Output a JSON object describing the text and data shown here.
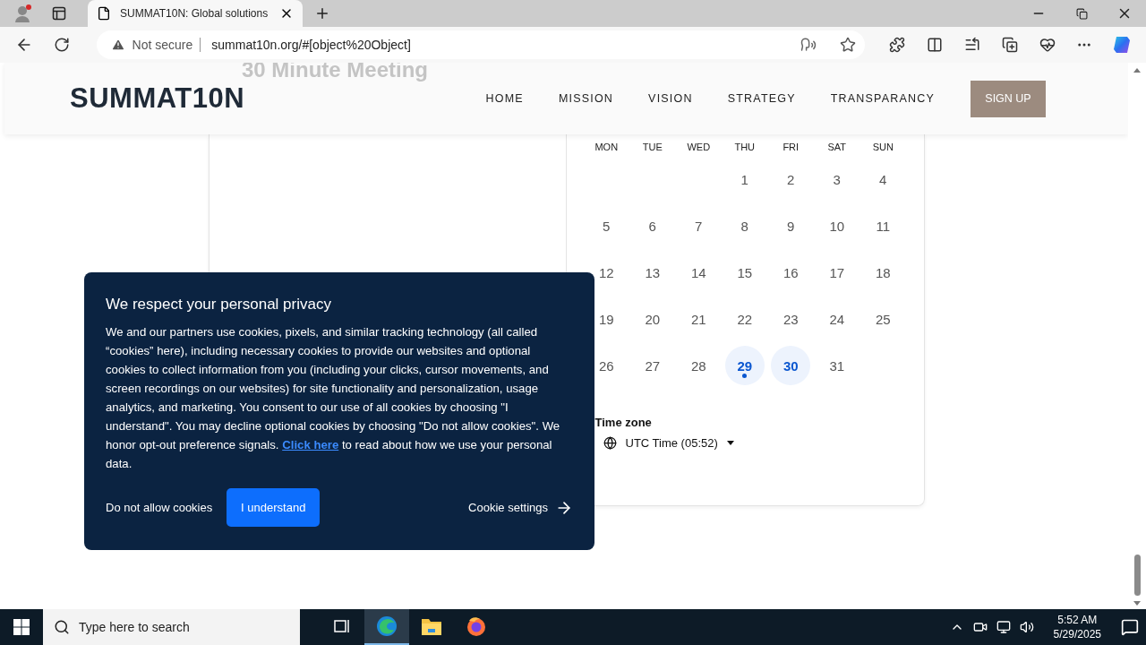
{
  "browser": {
    "tab": {
      "title": "SUMMAT10N: Global solutions"
    },
    "address": {
      "security": "Not secure",
      "url": "summat10n.org/#[object%20Object]"
    }
  },
  "ghost_title": "30 Minute Meeting",
  "header": {
    "logo": "SUMMAT10N",
    "nav": [
      "HOME",
      "MISSION",
      "VISION",
      "STRATEGY",
      "TRANSPARANCY"
    ],
    "cta": "SIGN UP"
  },
  "calendar": {
    "weekdays": [
      "MON",
      "TUE",
      "WED",
      "THU",
      "FRI",
      "SAT",
      "SUN"
    ],
    "weeks": [
      [
        {
          "day": "1",
          "available": false,
          "today": false
        },
        {
          "day": "2",
          "available": false,
          "today": false
        },
        {
          "day": "3",
          "available": false,
          "today": false
        },
        {
          "day": "4",
          "available": false,
          "today": false
        }
      ],
      [
        {
          "day": "5",
          "available": false,
          "today": false
        },
        {
          "day": "6",
          "available": false,
          "today": false
        },
        {
          "day": "7",
          "available": false,
          "today": false
        },
        {
          "day": "8",
          "available": false,
          "today": false
        },
        {
          "day": "9",
          "available": false,
          "today": false
        },
        {
          "day": "10",
          "available": false,
          "today": false
        },
        {
          "day": "11",
          "available": false,
          "today": false
        }
      ],
      [
        {
          "day": "12",
          "available": false,
          "today": false
        },
        {
          "day": "13",
          "available": false,
          "today": false
        },
        {
          "day": "14",
          "available": false,
          "today": false
        },
        {
          "day": "15",
          "available": false,
          "today": false
        },
        {
          "day": "16",
          "available": false,
          "today": false
        },
        {
          "day": "17",
          "available": false,
          "today": false
        },
        {
          "day": "18",
          "available": false,
          "today": false
        }
      ],
      [
        {
          "day": "19",
          "available": false,
          "today": false
        },
        {
          "day": "20",
          "available": false,
          "today": false
        },
        {
          "day": "21",
          "available": false,
          "today": false
        },
        {
          "day": "22",
          "available": false,
          "today": false
        },
        {
          "day": "23",
          "available": false,
          "today": false
        },
        {
          "day": "24",
          "available": false,
          "today": false
        },
        {
          "day": "25",
          "available": false,
          "today": false
        }
      ],
      [
        {
          "day": "26",
          "available": false,
          "today": false
        },
        {
          "day": "27",
          "available": false,
          "today": false
        },
        {
          "day": "28",
          "available": false,
          "today": false
        },
        {
          "day": "29",
          "available": true,
          "today": true
        },
        {
          "day": "30",
          "available": true,
          "today": false
        },
        {
          "day": "31",
          "available": false,
          "today": false
        }
      ]
    ],
    "timezone": {
      "label": "Time zone",
      "value": "UTC Time (05:52)"
    }
  },
  "cookie_banner": {
    "title": "We respect your personal privacy",
    "body_before": "We and our partners use cookies, pixels, and similar tracking technology (all called “cookies” here), including necessary cookies to provide our websites and optional cookies to collect information from you (including your clicks, cursor movements, and screen recordings on our websites) for site functionality and personalization, usage analytics, and marketing. You consent to our use of all cookies by choosing \"I understand\". You may decline optional cookies by choosing \"Do not allow cookies\". We honor opt-out preference signals. ",
    "link": "Click here",
    "body_after": " to read about how we use your personal data.",
    "decline": "Do not allow cookies",
    "accept": "I understand",
    "settings": "Cookie settings"
  },
  "taskbar": {
    "search_placeholder": "Type here to search",
    "apps": [
      {
        "kind": "taskview",
        "selected": false
      },
      {
        "kind": "edge",
        "selected": true
      },
      {
        "kind": "explorer",
        "selected": false
      },
      {
        "kind": "firefox",
        "selected": false
      }
    ],
    "time": "5:52 AM",
    "date": "5/29/2025"
  }
}
